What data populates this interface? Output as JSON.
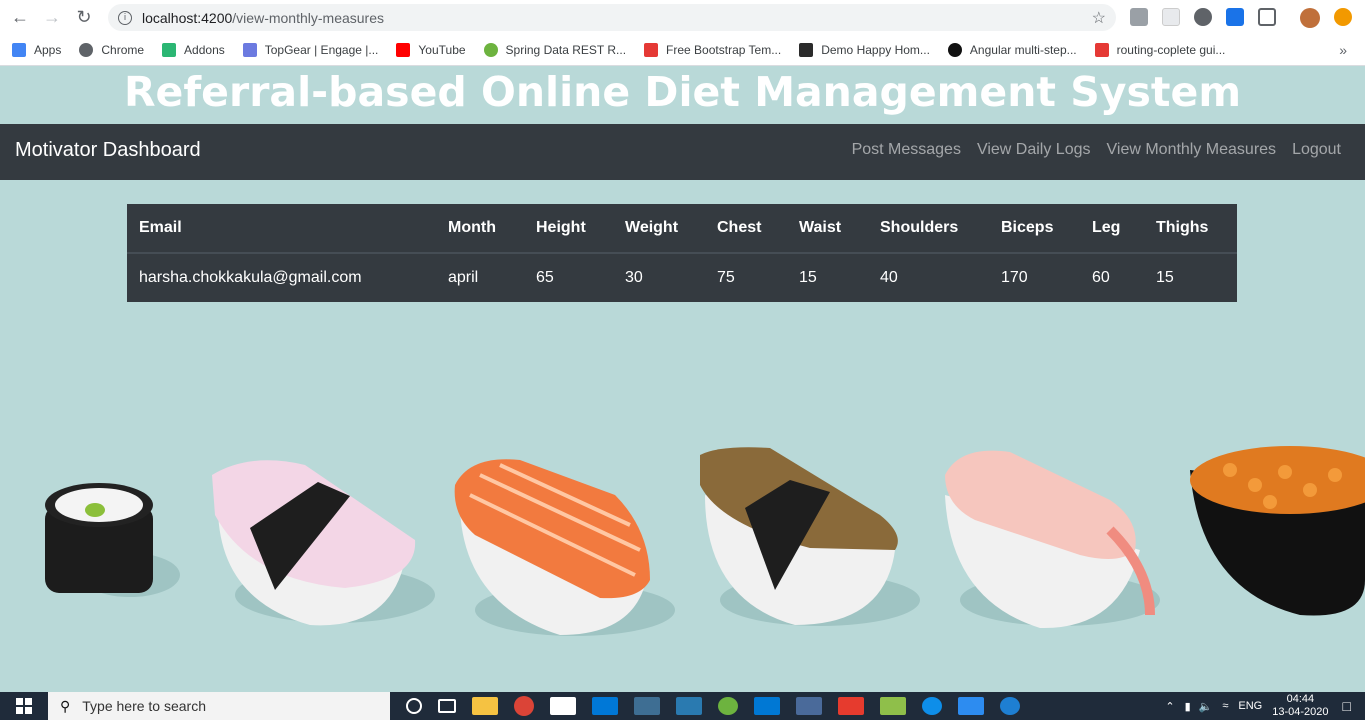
{
  "browser": {
    "url_host": "localhost:4200",
    "url_path": "/view-monthly-measures",
    "bookmarks": [
      {
        "label": "Apps",
        "color": "#4285f4"
      },
      {
        "label": "Chrome",
        "color": "#5f6368"
      },
      {
        "label": "Addons",
        "color": "#2bb673"
      },
      {
        "label": "TopGear | Engage |...",
        "color": "#6c7ae0"
      },
      {
        "label": "YouTube",
        "color": "#ff0000"
      },
      {
        "label": "Spring Data REST R...",
        "color": "#6db33f"
      },
      {
        "label": "Free Bootstrap Tem...",
        "color": "#e53935"
      },
      {
        "label": "Demo Happy Hom...",
        "color": "#2b2b2b"
      },
      {
        "label": "Angular multi-step...",
        "color": "#111111"
      },
      {
        "label": "routing-coplete gui...",
        "color": "#e53935"
      }
    ]
  },
  "page": {
    "title": "Referral-based Online Diet Management System"
  },
  "navbar": {
    "brand": "Motivator Dashboard",
    "links": [
      "Post Messages",
      "View Daily Logs",
      "View Monthly Measures",
      "Logout"
    ]
  },
  "table": {
    "headers": [
      "Email",
      "Month",
      "Height",
      "Weight",
      "Chest",
      "Waist",
      "Shoulders",
      "Biceps",
      "Leg",
      "Thighs"
    ],
    "rows": [
      [
        "harsha.chokkakula@gmail.com",
        "april",
        "65",
        "30",
        "75",
        "15",
        "40",
        "170",
        "60",
        "15"
      ]
    ]
  },
  "taskbar": {
    "search_placeholder": "Type here to search",
    "language": "ENG",
    "time": "04:44",
    "date": "13-04-2020"
  }
}
